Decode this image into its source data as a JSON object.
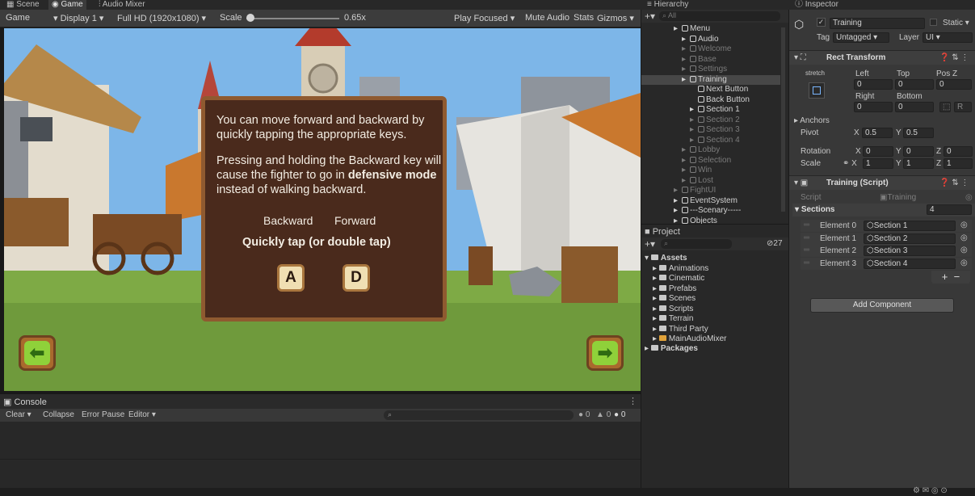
{
  "tabs": {
    "scene": "Scene",
    "game": "Game",
    "audio_mixer": "Audio Mixer",
    "hierarchy": "Hierarchy",
    "inspector": "Inspector"
  },
  "game_toolbar": {
    "view": "Game",
    "display": "Display 1",
    "resolution": "Full HD (1920x1080)",
    "scale_label": "Scale",
    "scale_value": "0.65x",
    "scale_fraction": 0.02,
    "play_focused": "Play Focused",
    "mute_audio": "Mute Audio",
    "stats": "Stats",
    "gizmos": "Gizmos"
  },
  "dialog": {
    "para1": "You can move forward and backward by quickly tapping the appropriate keys.",
    "para2_a": "Pressing and holding the Backward key will cause the fighter to go in ",
    "para2_bold1": "defensive mode",
    "para2_b": " instead of walking backward.",
    "col_backward": "Backward",
    "col_forward": "Forward",
    "instruction": "Quickly tap (or double tap)",
    "key_a": "A",
    "key_d": "D"
  },
  "console": {
    "title": "Console",
    "clear": "Clear",
    "collapse": "Collapse",
    "error_pause": "Error Pause",
    "editor": "Editor",
    "count_errors": "0",
    "count_warnings": "0",
    "count_logs": "0"
  },
  "hierarchy": {
    "search_placeholder": "All",
    "items": [
      {
        "label": "Menu",
        "dim": false,
        "indent": 0
      },
      {
        "label": "Audio",
        "dim": false,
        "indent": 1
      },
      {
        "label": "Welcome",
        "dim": true,
        "indent": 1
      },
      {
        "label": "Base",
        "dim": true,
        "indent": 1
      },
      {
        "label": "Settings",
        "dim": true,
        "indent": 1
      },
      {
        "label": "Training",
        "dim": false,
        "indent": 1,
        "selected": true
      },
      {
        "label": "Next Button",
        "dim": false,
        "indent": 2
      },
      {
        "label": "Back Button",
        "dim": false,
        "indent": 2
      },
      {
        "label": "Section 1",
        "dim": false,
        "indent": 2
      },
      {
        "label": "Section 2",
        "dim": true,
        "indent": 2
      },
      {
        "label": "Section 3",
        "dim": true,
        "indent": 2
      },
      {
        "label": "Section 4",
        "dim": true,
        "indent": 2
      },
      {
        "label": "Lobby",
        "dim": true,
        "indent": 1
      },
      {
        "label": "Selection",
        "dim": true,
        "indent": 1
      },
      {
        "label": "Win",
        "dim": true,
        "indent": 1
      },
      {
        "label": "Lost",
        "dim": true,
        "indent": 1
      },
      {
        "label": "FightUI",
        "dim": true,
        "indent": 0
      },
      {
        "label": "EventSystem",
        "dim": false,
        "indent": 0
      },
      {
        "label": "---Scenary-----",
        "dim": false,
        "indent": 0
      },
      {
        "label": "Objects",
        "dim": false,
        "indent": 0
      }
    ]
  },
  "project": {
    "title": "Project",
    "hidden_count": "27",
    "assets_label": "Assets",
    "folders": [
      "Animations",
      "Cinematic",
      "Prefabs",
      "Scenes",
      "Scripts",
      "Terrain",
      "Third Party",
      "MainAudioMixer"
    ],
    "packages_label": "Packages"
  },
  "inspector": {
    "object_name": "Training",
    "static_label": "Static",
    "tag_label": "Tag",
    "tag_value": "Untagged",
    "layer_label": "Layer",
    "layer_value": "UI",
    "rect_transform": "Rect Transform",
    "stretch": "stretch",
    "left_label": "Left",
    "top_label": "Top",
    "posz_label": "Pos Z",
    "left_value": "0",
    "top_value": "0",
    "posz_value": "0",
    "right_label": "Right",
    "bottom_label": "Bottom",
    "right_value": "0",
    "bottom_value": "0",
    "r_button": "R",
    "anchors": "Anchors",
    "pivot_label": "Pivot",
    "pivot_x": "0.5",
    "pivot_y": "0.5",
    "rotation_label": "Rotation",
    "rot_x": "0",
    "rot_y": "0",
    "rot_z": "0",
    "scale_label": "Scale",
    "scale_x": "1",
    "scale_y": "1",
    "scale_z": "1",
    "script_component": "Training (Script)",
    "script_label": "Script",
    "script_value": "Training",
    "sections_label": "Sections",
    "sections_count": "4",
    "elements": [
      {
        "label": "Element 0",
        "value": "Section 1"
      },
      {
        "label": "Element 1",
        "value": "Section 2"
      },
      {
        "label": "Element 2",
        "value": "Section 3"
      },
      {
        "label": "Element 3",
        "value": "Section 4"
      }
    ],
    "add_component": "Add Component"
  },
  "colors": {
    "panel_dark": "#282828",
    "panel": "#383838",
    "selection": "#474747",
    "dialog_bg": "#4a2a1c",
    "dialog_border": "#8f5a30",
    "arrow_green": "#8fd13a"
  }
}
